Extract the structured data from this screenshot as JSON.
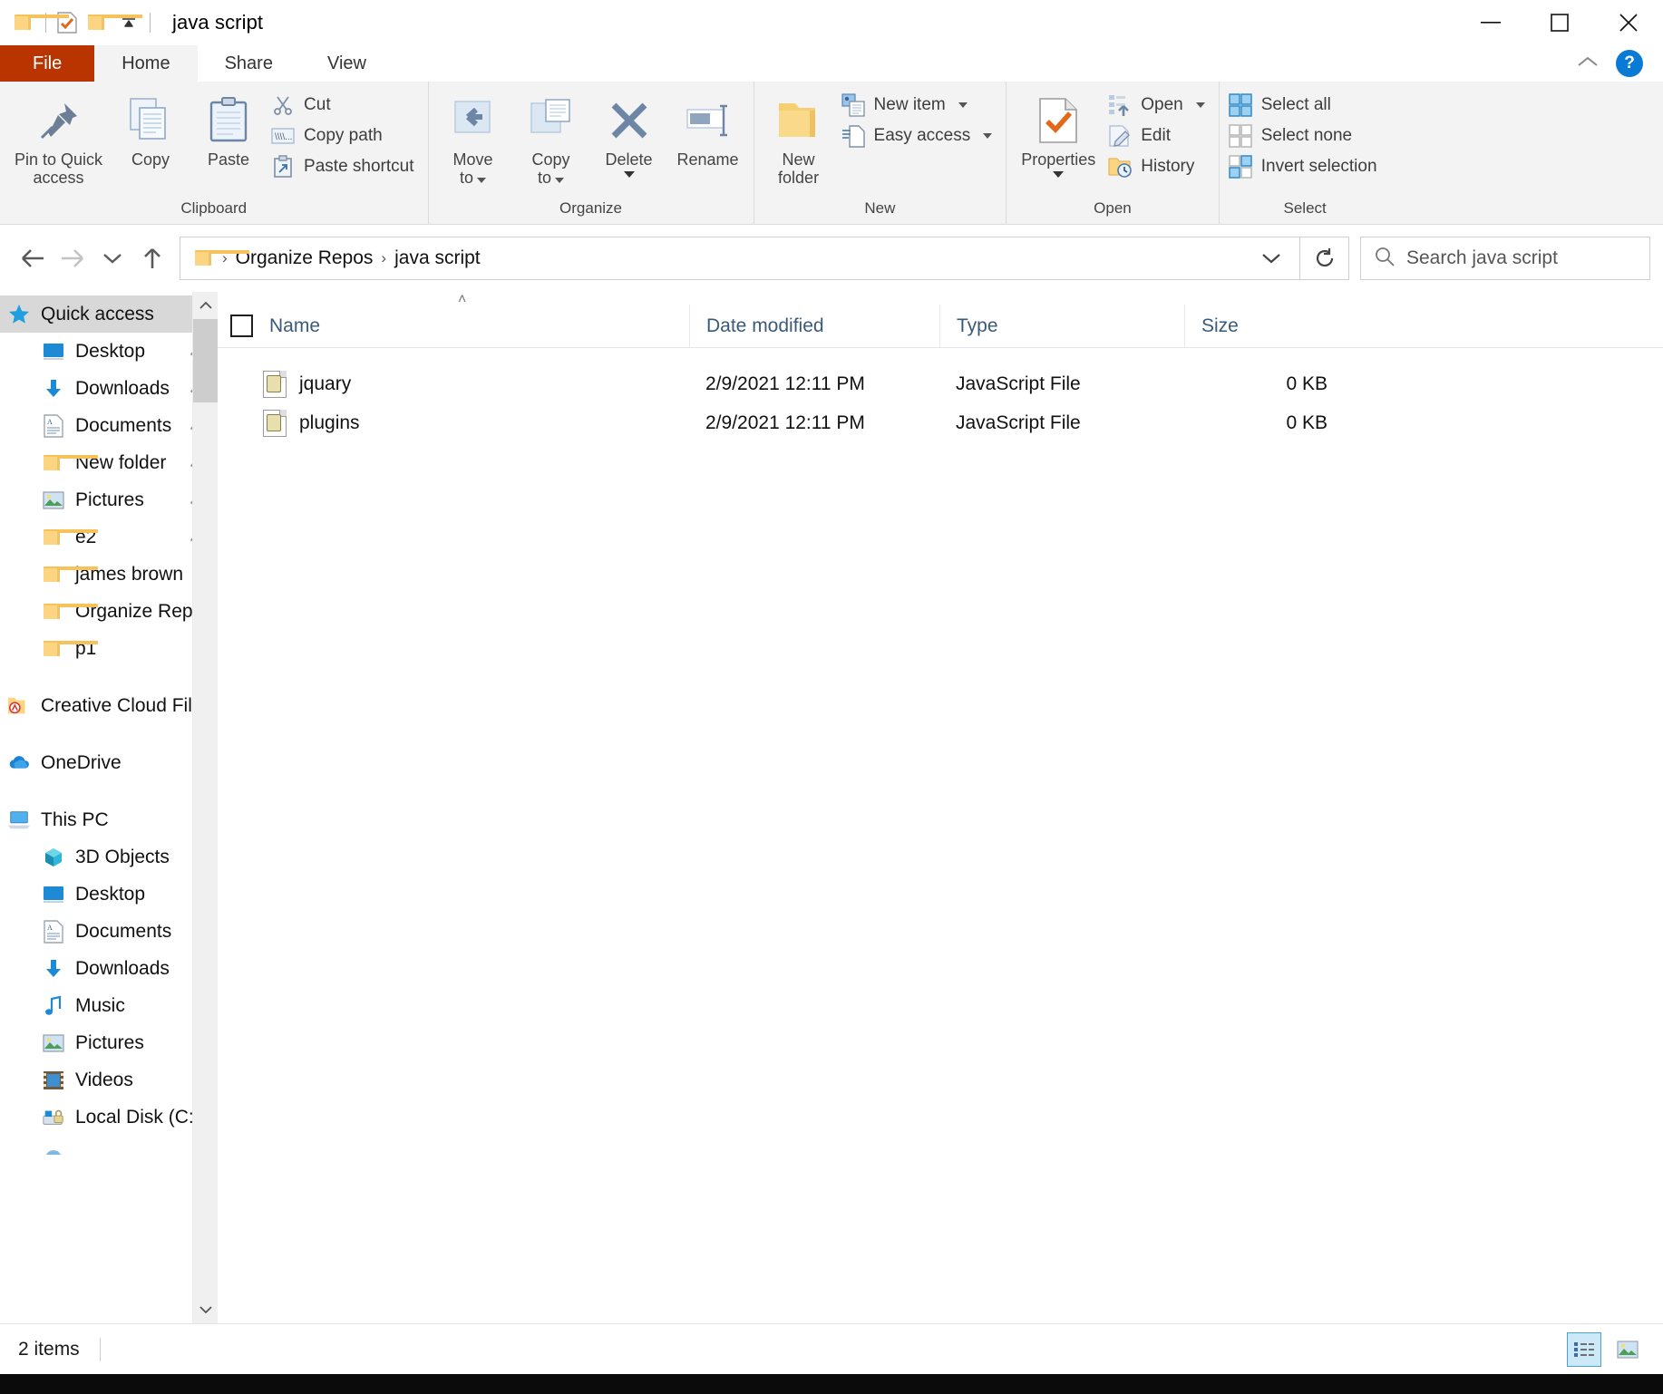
{
  "window": {
    "title": "java script",
    "quick_access_toolbar": [
      {
        "name": "folder-icon",
        "label": "Folder"
      },
      {
        "name": "properties-check-icon",
        "label": "Properties"
      },
      {
        "name": "new-folder-icon",
        "label": "New folder"
      },
      {
        "name": "customize-qat-icon",
        "label": "Customize Quick Access Toolbar"
      }
    ],
    "controls": {
      "minimize": "—",
      "maximize": "□",
      "close": "✕"
    }
  },
  "tabs": [
    {
      "label": "File",
      "active": false,
      "file": true
    },
    {
      "label": "Home",
      "active": true,
      "file": false
    },
    {
      "label": "Share",
      "active": false,
      "file": false
    },
    {
      "label": "View",
      "active": false,
      "file": false
    }
  ],
  "tab_right": {
    "collapse_label": "Collapse the Ribbon",
    "help_label": "?"
  },
  "ribbon": {
    "groups": [
      {
        "name": "clipboard",
        "label": "Clipboard",
        "big_buttons": [
          {
            "label": "Pin to Quick\naccess",
            "icon": "pin-icon"
          },
          {
            "label": "Copy",
            "icon": "copy-icon"
          },
          {
            "label": "Paste",
            "icon": "paste-icon"
          }
        ],
        "small_buttons": [
          {
            "label": "Cut",
            "icon": "scissors-icon"
          },
          {
            "label": "Copy path",
            "icon": "copy-path-icon"
          },
          {
            "label": "Paste shortcut",
            "icon": "paste-shortcut-icon"
          }
        ]
      },
      {
        "name": "organize",
        "label": "Organize",
        "big_buttons": [
          {
            "label": "Move\nto",
            "icon": "move-to-icon",
            "dropdown": true
          },
          {
            "label": "Copy\nto",
            "icon": "copy-to-icon",
            "dropdown": true
          },
          {
            "label": "Delete",
            "icon": "delete-x-icon",
            "dropdown": true
          },
          {
            "label": "Rename",
            "icon": "rename-icon"
          }
        ],
        "small_buttons": []
      },
      {
        "name": "new",
        "label": "New",
        "big_buttons": [
          {
            "label": "New\nfolder",
            "icon": "new-folder-icon"
          }
        ],
        "small_buttons": [
          {
            "label": "New item",
            "icon": "new-item-icon",
            "dropdown": true
          },
          {
            "label": "Easy access",
            "icon": "easy-access-icon",
            "dropdown": true
          }
        ]
      },
      {
        "name": "open",
        "label": "Open",
        "big_buttons": [
          {
            "label": "Properties",
            "icon": "properties-icon",
            "dropdown": true
          }
        ],
        "small_buttons": [
          {
            "label": "Open",
            "icon": "open-icon",
            "dropdown": true
          },
          {
            "label": "Edit",
            "icon": "edit-icon"
          },
          {
            "label": "History",
            "icon": "history-icon"
          }
        ]
      },
      {
        "name": "select",
        "label": "Select",
        "big_buttons": [],
        "small_buttons": [
          {
            "label": "Select all",
            "icon": "select-all-icon"
          },
          {
            "label": "Select none",
            "icon": "select-none-icon"
          },
          {
            "label": "Invert selection",
            "icon": "invert-selection-icon"
          }
        ]
      }
    ]
  },
  "navbar": {
    "back_label": "Back",
    "forward_label": "Forward",
    "recent_label": "Recent locations",
    "up_label": "Up",
    "breadcrumbs": [
      "Organize Repos",
      "java script"
    ],
    "breadcrumb_separator": "›",
    "refresh_label": "Refresh",
    "dropdown_label": "Previous locations"
  },
  "search": {
    "placeholder": "Search java script",
    "value": "",
    "icon": "search-icon"
  },
  "sidebar": {
    "sections": [
      {
        "name": "quick-access",
        "root": {
          "label": "Quick access",
          "icon": "star-icon",
          "selected": true
        },
        "items": [
          {
            "label": "Desktop",
            "icon": "desktop-icon",
            "pinned": true
          },
          {
            "label": "Downloads",
            "icon": "downloads-icon",
            "pinned": true
          },
          {
            "label": "Documents",
            "icon": "documents-icon",
            "pinned": true
          },
          {
            "label": "New folder",
            "icon": "folder-icon",
            "pinned": true
          },
          {
            "label": "Pictures",
            "icon": "pictures-icon",
            "pinned": true
          },
          {
            "label": "e2",
            "icon": "folder-icon",
            "pinned": true
          },
          {
            "label": "james brown",
            "icon": "folder-icon",
            "pinned": false
          },
          {
            "label": "Organize Repos",
            "icon": "folder-icon",
            "pinned": false
          },
          {
            "label": "p1",
            "icon": "folder-icon",
            "pinned": false
          }
        ]
      },
      {
        "name": "creative-cloud",
        "root": {
          "label": "Creative Cloud File",
          "icon": "creative-cloud-folder-icon",
          "selected": false
        },
        "items": []
      },
      {
        "name": "onedrive",
        "root": {
          "label": "OneDrive",
          "icon": "onedrive-icon",
          "selected": false
        },
        "items": []
      },
      {
        "name": "this-pc",
        "root": {
          "label": "This PC",
          "icon": "this-pc-icon",
          "selected": false
        },
        "items": [
          {
            "label": "3D Objects",
            "icon": "3d-objects-icon",
            "pinned": false
          },
          {
            "label": "Desktop",
            "icon": "desktop-icon",
            "pinned": false
          },
          {
            "label": "Documents",
            "icon": "documents-icon",
            "pinned": false
          },
          {
            "label": "Downloads",
            "icon": "downloads-icon",
            "pinned": false
          },
          {
            "label": "Music",
            "icon": "music-icon",
            "pinned": false
          },
          {
            "label": "Pictures",
            "icon": "pictures-icon",
            "pinned": false
          },
          {
            "label": "Videos",
            "icon": "videos-icon",
            "pinned": false
          },
          {
            "label": "Local Disk (C:)",
            "icon": "local-disk-icon",
            "pinned": false
          }
        ]
      }
    ]
  },
  "filelist": {
    "sort_indicator": "˄",
    "columns": [
      {
        "label": "Name",
        "key": "name"
      },
      {
        "label": "Date modified",
        "key": "date"
      },
      {
        "label": "Type",
        "key": "type"
      },
      {
        "label": "Size",
        "key": "size"
      }
    ],
    "rows": [
      {
        "name": "jquary",
        "date": "2/9/2021 12:11 PM",
        "type": "JavaScript File",
        "size": "0 KB",
        "icon": "javascript-file-icon"
      },
      {
        "name": "plugins",
        "date": "2/9/2021 12:11 PM",
        "type": "JavaScript File",
        "size": "0 KB",
        "icon": "javascript-file-icon"
      }
    ]
  },
  "statusbar": {
    "item_count": "2 items",
    "views": [
      {
        "name": "details-view-button",
        "label": "Details view",
        "active": true
      },
      {
        "name": "large-icons-view-button",
        "label": "Large icons view",
        "active": false
      }
    ]
  }
}
